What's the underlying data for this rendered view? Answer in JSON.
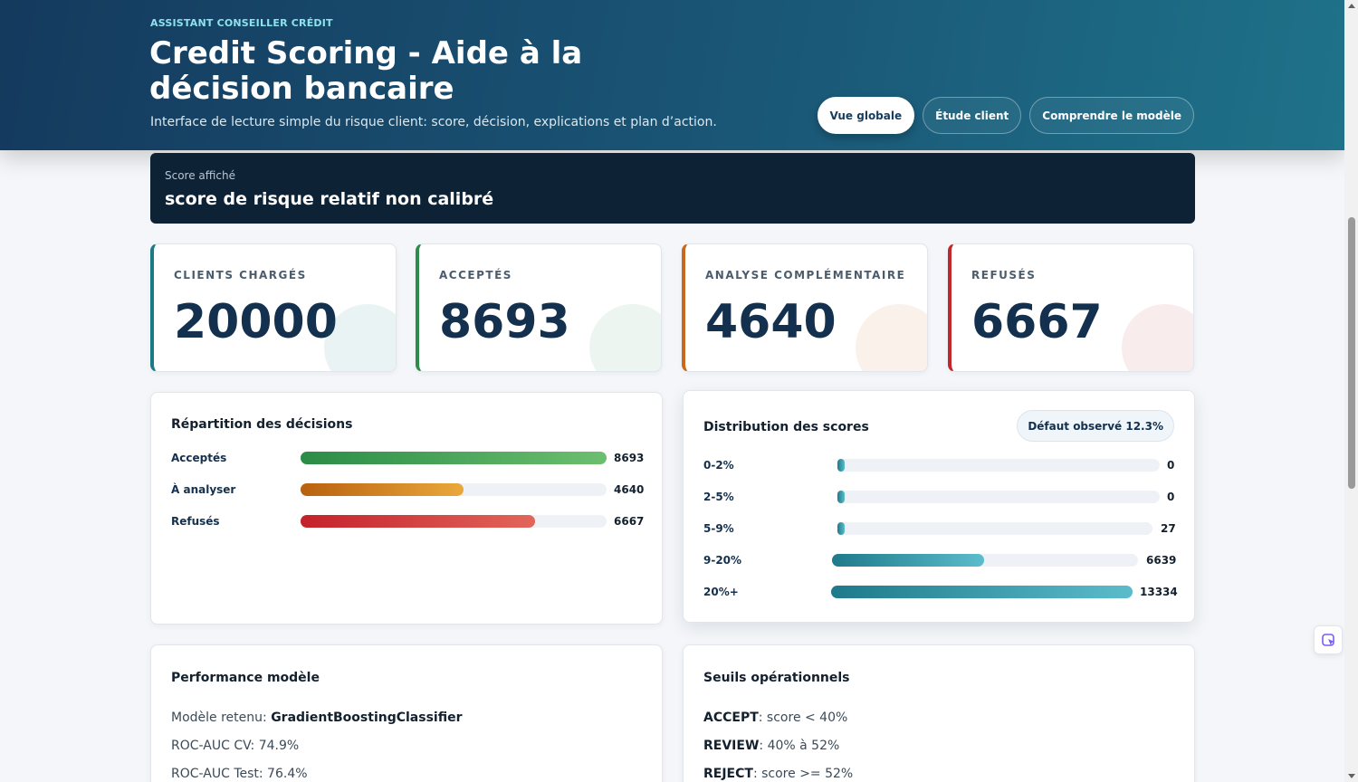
{
  "header": {
    "eyebrow": "ASSISTANT CONSEILLER CRÉDIT",
    "title": "Credit Scoring - Aide à la décision bancaire",
    "subtitle": "Interface de lecture simple du risque client: score, décision, explications et plan d’action.",
    "nav": [
      {
        "label": "Vue globale",
        "active": true
      },
      {
        "label": "Étude client",
        "active": false
      },
      {
        "label": "Comprendre le modèle",
        "active": false
      }
    ]
  },
  "banner": {
    "label": "Score affiché",
    "value": "score de risque relatif non calibré"
  },
  "kpis": [
    {
      "label": "CLIENTS CHARGÉS",
      "value": "20000",
      "accent": "#1b7a86"
    },
    {
      "label": "ACCEPTÉS",
      "value": "8693",
      "accent": "#2e8b4a"
    },
    {
      "label": "ANALYSE COMPLÉMENTAIRE",
      "value": "4640",
      "accent": "#c8691e"
    },
    {
      "label": "REFUSÉS",
      "value": "6667",
      "accent": "#c0282b"
    }
  ],
  "decisions": {
    "title": "Répartition des décisions",
    "rows": [
      {
        "label": "Acceptés",
        "value": "8693",
        "fraction": 1.0,
        "colors": [
          "#2b8c47",
          "#6cbf6f"
        ]
      },
      {
        "label": "À analyser",
        "value": "4640",
        "fraction": 0.534,
        "colors": [
          "#b8610f",
          "#eaa83b"
        ]
      },
      {
        "label": "Refusés",
        "value": "6667",
        "fraction": 0.767,
        "colors": [
          "#c4212b",
          "#e2655a"
        ]
      }
    ]
  },
  "scores": {
    "title": "Distribution des scores",
    "badge": "Défaut observé 12.3%",
    "rows": [
      {
        "label": "0-2%",
        "value": "0",
        "fraction": 0.0
      },
      {
        "label": "2-5%",
        "value": "0",
        "fraction": 0.0
      },
      {
        "label": "5-9%",
        "value": "27",
        "fraction": 0.002
      },
      {
        "label": "9-20%",
        "value": "6639",
        "fraction": 0.498
      },
      {
        "label": "20%+",
        "value": "13334",
        "fraction": 1.0
      }
    ],
    "colors": [
      "#1e7a8a",
      "#5bbccb"
    ]
  },
  "performance": {
    "title": "Performance modèle",
    "model_label": "Modèle retenu: ",
    "model_value": "GradientBoostingClassifier",
    "roc_cv": "ROC-AUC CV: 74.9%",
    "roc_test": "ROC-AUC Test: 76.4%"
  },
  "thresholds": {
    "title": "Seuils opérationnels",
    "accept_key": "ACCEPT",
    "accept_rule": ": score < 40%",
    "review_key": "REVIEW",
    "review_rule": ": 40% à 52%",
    "reject_key": "REJECT",
    "reject_rule": ": score >= 52%"
  },
  "icons": {
    "side_widget": "cursor-pointer-icon"
  }
}
